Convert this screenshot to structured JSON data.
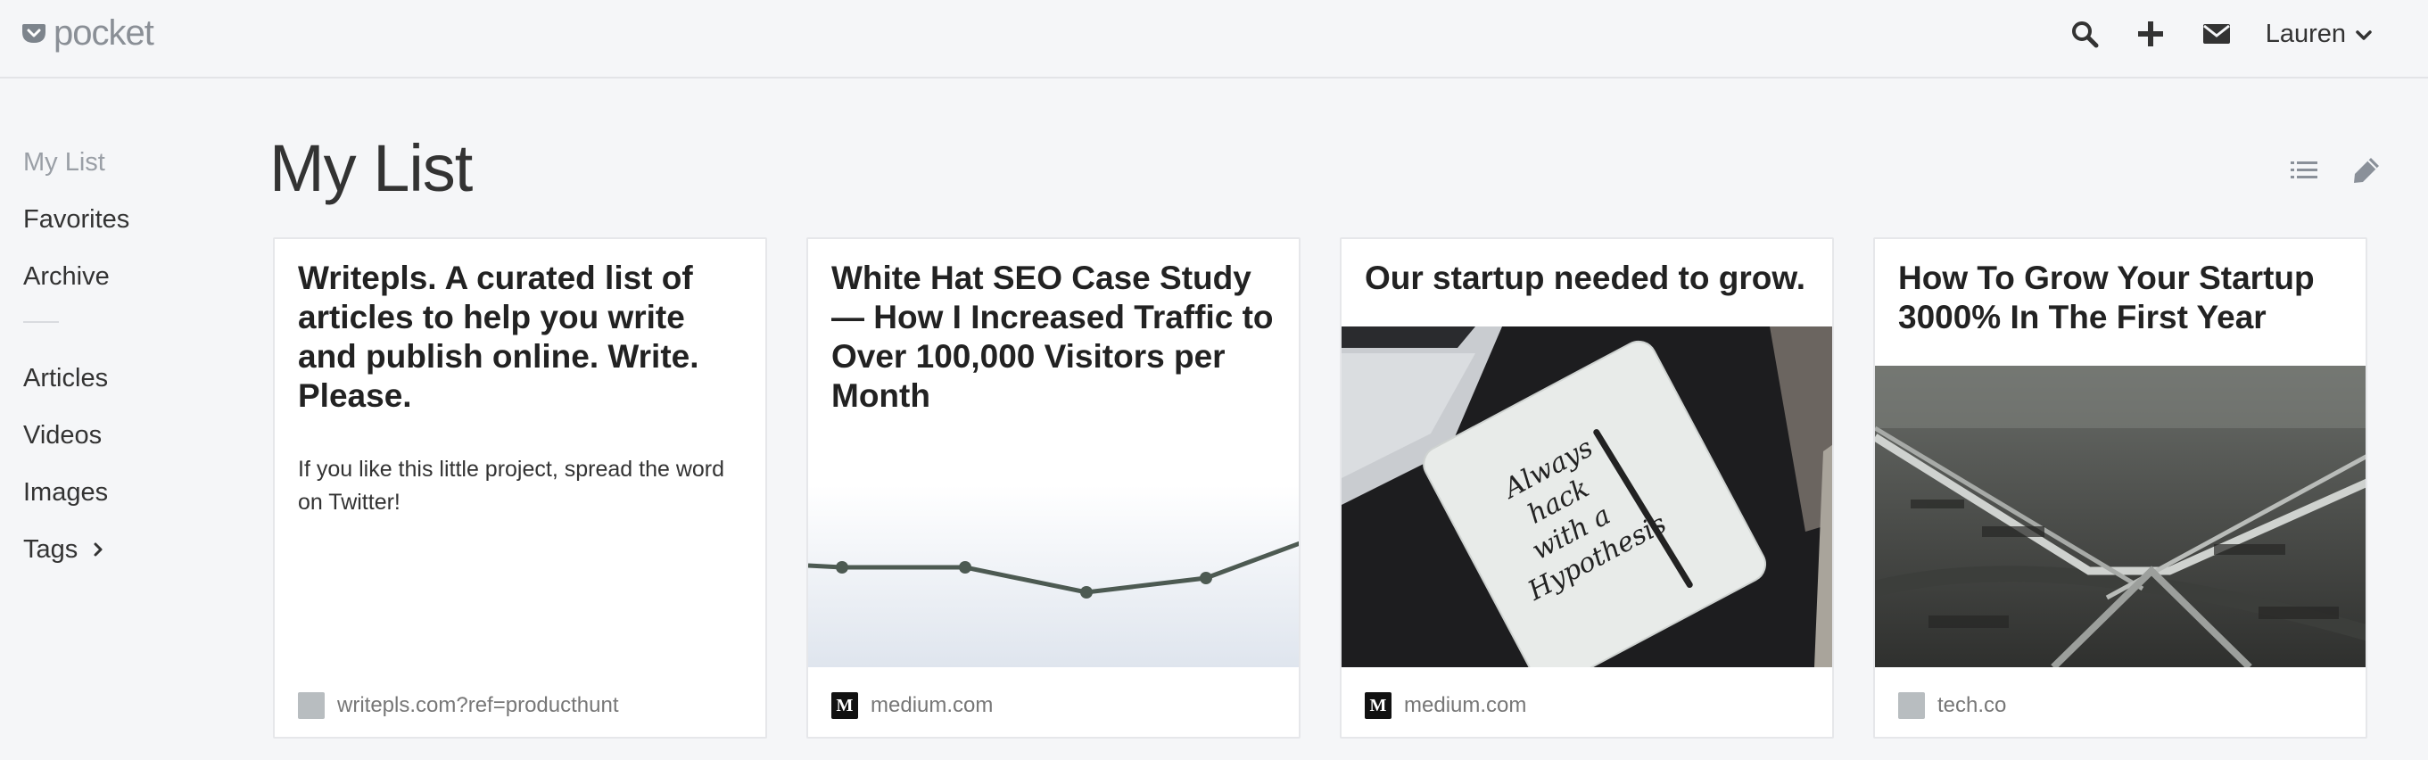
{
  "app": {
    "logo_text": "pocket",
    "brand_color": "#ef4056"
  },
  "header": {
    "actions": [
      {
        "name": "search-icon",
        "icon": "magnifier"
      },
      {
        "name": "add-icon",
        "icon": "plus"
      },
      {
        "name": "mail-icon",
        "icon": "envelope"
      }
    ],
    "user_name": "Lauren"
  },
  "sidebar": {
    "items": [
      {
        "label": "My List",
        "active": true
      },
      {
        "label": "Favorites"
      },
      {
        "label": "Archive"
      },
      {
        "label": "Articles"
      },
      {
        "label": "Videos"
      },
      {
        "label": "Images"
      },
      {
        "label": "Tags",
        "has_chevron": true
      }
    ]
  },
  "main": {
    "title": "My List",
    "view_tools": [
      "list-view-icon",
      "edit-icon"
    ],
    "cards": [
      {
        "title": "Writepls. A curated list of articles to help you write and publish online. Write. Please.",
        "excerpt": "If you like this little project, spread the word on Twitter!",
        "image": "none",
        "source": "writepls.com?ref=producthunt",
        "favicon": "gray"
      },
      {
        "title": "White Hat SEO Case Study— How I Increased Traffic to Over 100,000 Visitors per Month",
        "excerpt": "",
        "image": "line-graph",
        "source": "medium.com",
        "favicon": "medium"
      },
      {
        "title": "Our startup needed to grow.",
        "excerpt": "",
        "image": "notebook-photo",
        "notebook_text": "Always hack with a Hypothesis",
        "source": "medium.com",
        "favicon": "medium"
      },
      {
        "title": "How To Grow Your Startup 3000% In The First Year",
        "excerpt": "",
        "image": "railroad-photo",
        "source": "tech.co",
        "favicon": "gray"
      }
    ]
  }
}
